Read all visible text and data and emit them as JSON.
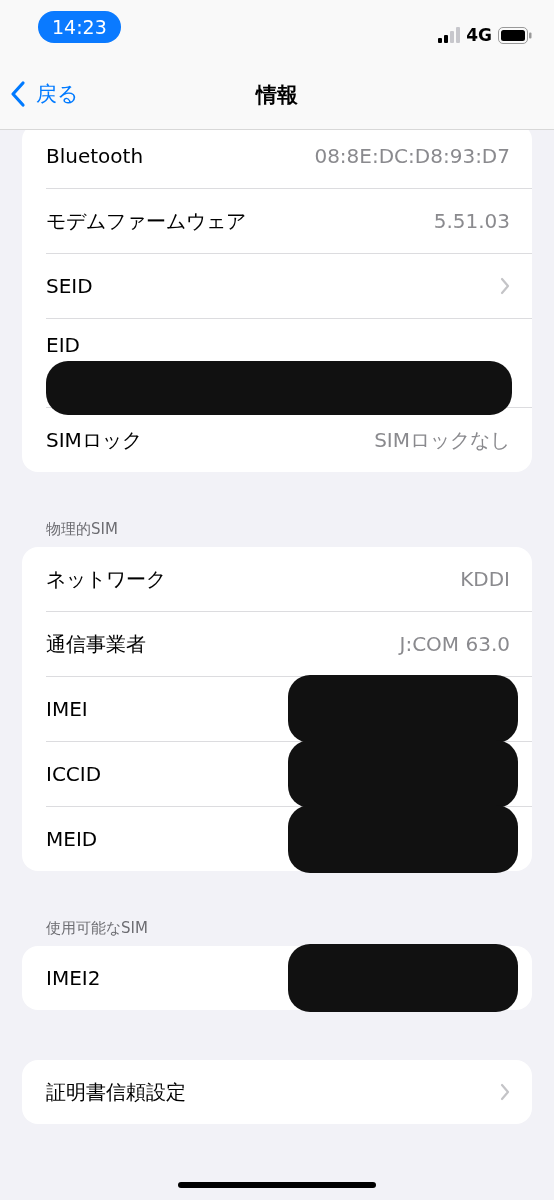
{
  "status_bar": {
    "time": "14:23",
    "network": "4G"
  },
  "nav": {
    "back": "戻る",
    "title": "情報"
  },
  "groups": [
    {
      "rows": [
        {
          "kind": "value",
          "label": "Bluetooth",
          "value": "08:8E:DC:D8:93:D7"
        },
        {
          "kind": "value",
          "label": "モデムファームウェア",
          "value": "5.51.03"
        },
        {
          "kind": "chevron",
          "label": "SEID"
        },
        {
          "kind": "stacked",
          "label": "EID",
          "redacted": true
        },
        {
          "kind": "value",
          "label": "SIMロック",
          "value": "SIMロックなし"
        }
      ]
    },
    {
      "header": "物理的SIM",
      "rows": [
        {
          "kind": "value",
          "label": "ネットワーク",
          "value": "KDDI"
        },
        {
          "kind": "value",
          "label": "通信事業者",
          "value": "J:COM 63.0"
        },
        {
          "kind": "value",
          "label": "IMEI",
          "redacted": true
        },
        {
          "kind": "value",
          "label": "ICCID",
          "redacted": true
        },
        {
          "kind": "value",
          "label": "MEID",
          "redacted": true
        }
      ]
    },
    {
      "header": "使用可能なSIM",
      "rows": [
        {
          "kind": "value",
          "label": "IMEI2",
          "redacted": true
        }
      ]
    },
    {
      "rows": [
        {
          "kind": "chevron",
          "label": "証明書信頼設定"
        }
      ]
    }
  ]
}
